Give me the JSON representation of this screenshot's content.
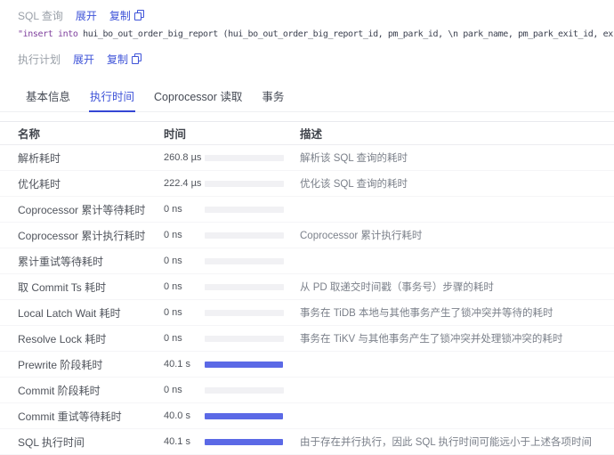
{
  "colors": {
    "primary": "#3e53d8",
    "bar_blue": "#5b69e6",
    "bar_gray": "#f1f1f4"
  },
  "sql_section": {
    "label": "SQL 查询",
    "expand": "展开",
    "copy": "复制",
    "sql_keyword": "\"insert into",
    "sql_rest": " hui_bo_out_order_big_report (hui_bo_out_order_big_report_id, pm_park_id, \\n park_name, pm_park_exit_id, ex"
  },
  "plan_section": {
    "label": "执行计划",
    "expand": "展开",
    "copy": "复制"
  },
  "tabs": [
    {
      "label": "基本信息",
      "cls": "tab"
    },
    {
      "label": "执行时间",
      "cls": "tab active"
    },
    {
      "label": "Coprocessor 读取",
      "cls": "tab"
    },
    {
      "label": "事务",
      "cls": "tab"
    }
  ],
  "table": {
    "headers": [
      "名称",
      "时间",
      "描述"
    ],
    "rows": [
      {
        "name": "解析耗时",
        "time": "260.8 µs",
        "bar_class": "bar gray",
        "desc": "解析该 SQL 查询的耗时"
      },
      {
        "name": "优化耗时",
        "time": "222.4 µs",
        "bar_class": "bar gray",
        "desc": "优化该 SQL 查询的耗时"
      },
      {
        "name": "Coprocessor 累计等待耗时",
        "time": "0 ns",
        "bar_class": "bar gray",
        "desc": ""
      },
      {
        "name": "Coprocessor 累计执行耗时",
        "time": "0 ns",
        "bar_class": "bar gray",
        "desc": "Coprocessor 累计执行耗时"
      },
      {
        "name": "累计重试等待耗时",
        "time": "0 ns",
        "bar_class": "bar gray",
        "desc": ""
      },
      {
        "name": "取 Commit Ts 耗时",
        "time": "0 ns",
        "bar_class": "bar gray",
        "desc": "从 PD 取递交时间戳（事务号）步骤的耗时"
      },
      {
        "name": "Local Latch Wait 耗时",
        "time": "0 ns",
        "bar_class": "bar gray",
        "desc": "事务在 TiDB 本地与其他事务产生了锁冲突并等待的耗时"
      },
      {
        "name": "Resolve Lock 耗时",
        "time": "0 ns",
        "bar_class": "bar gray",
        "desc": "事务在 TiKV 与其他事务产生了锁冲突并处理锁冲突的耗时"
      },
      {
        "name": "Prewrite 阶段耗时",
        "time": "40.1 s",
        "bar_class": "bar blue",
        "desc": ""
      },
      {
        "name": "Commit 阶段耗时",
        "time": "0 ns",
        "bar_class": "bar gray",
        "desc": ""
      },
      {
        "name": "Commit 重试等待耗时",
        "time": "40.0 s",
        "bar_class": "bar blue",
        "desc": ""
      },
      {
        "name": "SQL 执行时间",
        "time": "40.1 s",
        "bar_class": "bar blue",
        "desc": "由于存在并行执行，因此 SQL 执行时间可能远小于上述各项时间"
      }
    ]
  }
}
